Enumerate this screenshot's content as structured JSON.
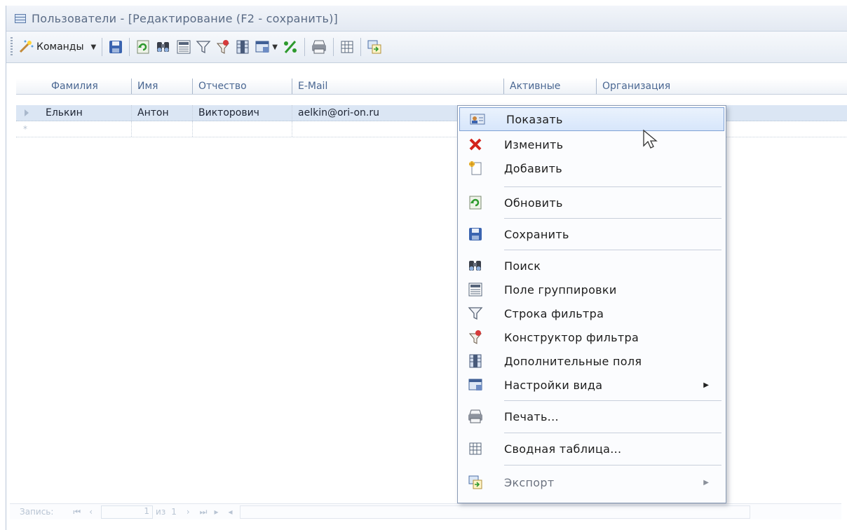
{
  "window": {
    "title": "Пользователи - [Редактирование (F2 - сохранить)]"
  },
  "toolbar": {
    "commands_label": "Команды"
  },
  "grid": {
    "columns": [
      "Фамилия",
      "Имя",
      "Отчество",
      "E-Mail",
      "Активные",
      "Организация"
    ],
    "rows": [
      {
        "last_name": "Елькин",
        "first_name": "Антон",
        "middle_name": "Викторович",
        "email": "aelkin@ori-on.ru"
      }
    ],
    "new_row_marker": "*"
  },
  "status": {
    "record_label": "Запись:",
    "position": "1",
    "of_label": "из",
    "total": "1"
  },
  "context_menu": {
    "items": [
      {
        "label": "Показать",
        "icon": "show-card-icon",
        "highlighted": true
      },
      {
        "label": "Изменить",
        "icon": "red-cross-icon"
      },
      {
        "label": "Добавить",
        "icon": "new-document-icon"
      },
      {
        "label": "Обновить",
        "icon": "refresh-icon"
      },
      {
        "label": "Сохранить",
        "icon": "floppy-disk-icon"
      },
      {
        "label": "Поиск",
        "icon": "binoculars-icon"
      },
      {
        "label": "Поле группировки",
        "icon": "group-panel-icon"
      },
      {
        "label": "Строка фильтра",
        "icon": "funnel-icon"
      },
      {
        "label": "Конструктор фильтра",
        "icon": "filter-builder-icon"
      },
      {
        "label": "Дополнительные поля",
        "icon": "column-chooser-icon"
      },
      {
        "label": "Настройки вида",
        "icon": "view-settings-icon",
        "submenu": true
      },
      {
        "label": "Печать...",
        "icon": "printer-icon"
      },
      {
        "label": "Сводная таблица...",
        "icon": "pivot-table-icon"
      },
      {
        "label": "Экспорт",
        "icon": "export-icon",
        "submenu": true,
        "disabled": true
      }
    ]
  },
  "colors": {
    "selection": "#dbe6f4",
    "accent": "#7fa1d4",
    "delete": "#d3231b"
  }
}
